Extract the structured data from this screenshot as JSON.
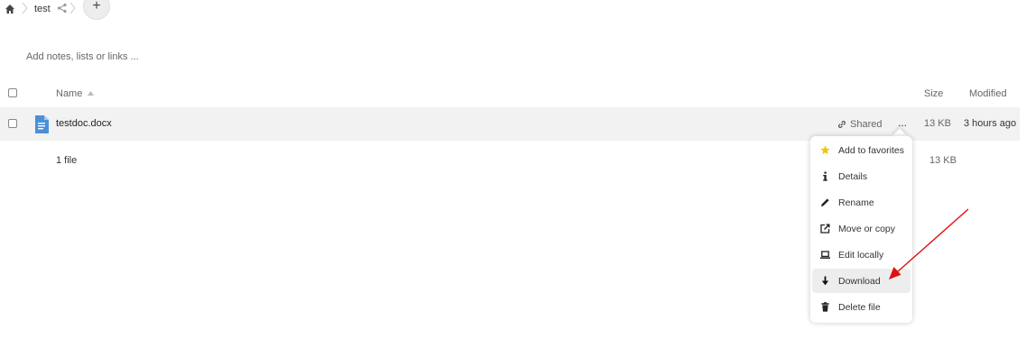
{
  "breadcrumb": {
    "folder": "test"
  },
  "new_button_label": "+",
  "notes_placeholder": "Add notes, lists or links ...",
  "table": {
    "headers": {
      "name": "Name",
      "size": "Size",
      "modified": "Modified"
    },
    "rows": [
      {
        "name": "testdoc.docx",
        "shared_label": "Shared",
        "more_label": "...",
        "size": "13 KB",
        "modified": "3 hours ago"
      }
    ],
    "summary": {
      "count": "1 file",
      "size": "13 KB"
    }
  },
  "menu": {
    "items": [
      {
        "label": "Add to favorites",
        "icon": "star-icon"
      },
      {
        "label": "Details",
        "icon": "info-icon"
      },
      {
        "label": "Rename",
        "icon": "pencil-icon"
      },
      {
        "label": "Move or copy",
        "icon": "external-link-icon"
      },
      {
        "label": "Edit locally",
        "icon": "laptop-icon"
      },
      {
        "label": "Download",
        "icon": "download-icon"
      },
      {
        "label": "Delete file",
        "icon": "trash-icon"
      }
    ],
    "highlighted": "Download"
  },
  "colors": {
    "file_icon": "#4a90d9",
    "star": "#f1c40f",
    "arrow": "#e01010",
    "row_bg": "#f2f2f2"
  }
}
